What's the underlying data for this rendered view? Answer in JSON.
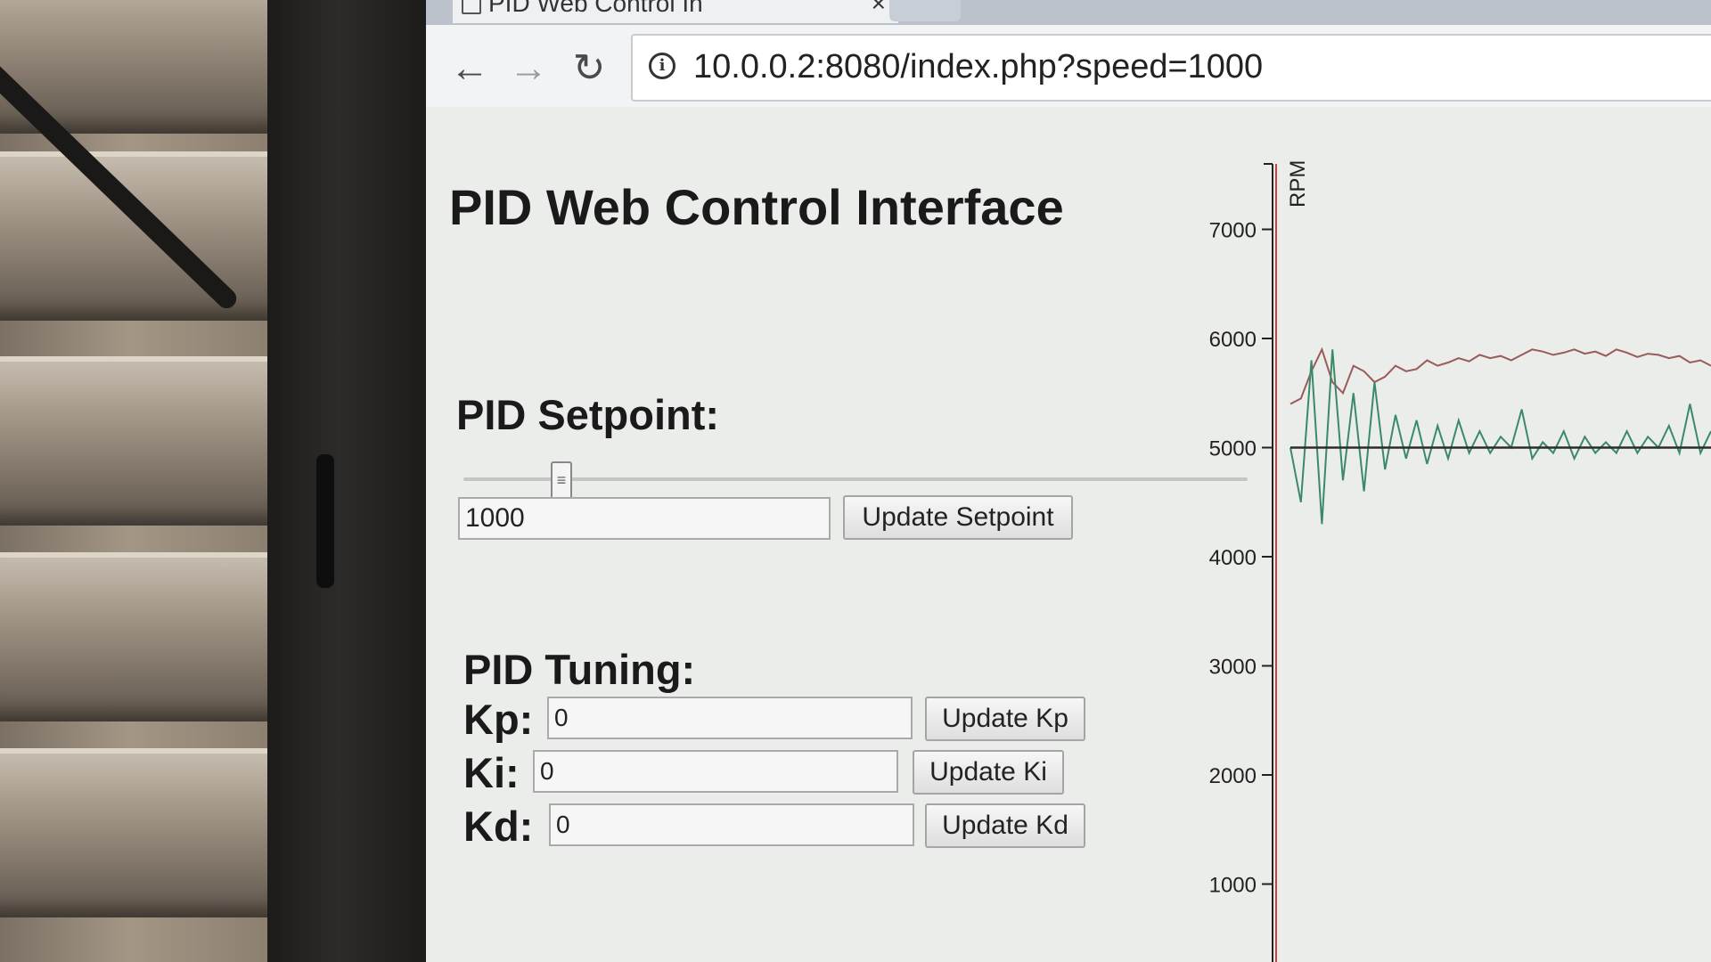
{
  "browser": {
    "tab_title": "PID Web Control In",
    "url": "10.0.0.2:8080/index.php?speed=1000"
  },
  "page": {
    "title": "PID Web Control Interface",
    "setpoint": {
      "heading": "PID Setpoint:",
      "slider_value": 1000,
      "slider_max": 8000,
      "input_value": "1000",
      "button_label": "Update Setpoint"
    },
    "tuning": {
      "heading": "PID Tuning:",
      "kp": {
        "label": "Kp:",
        "value": "0",
        "button_label": "Update Kp"
      },
      "ki": {
        "label": "Ki:",
        "value": "0",
        "button_label": "Update Ki"
      },
      "kd": {
        "label": "Kd:",
        "value": "0",
        "button_label": "Update Kd"
      }
    }
  },
  "colors": {
    "target_line": "#2c2c2c",
    "rpm_series": "#9a5a5a",
    "error_series": "#3a8a6a",
    "axis_red": "#d04040"
  },
  "chart_data": {
    "type": "line",
    "ylabel": "RPM",
    "ylim": [
      0,
      7800
    ],
    "yticks": [
      1000,
      2000,
      3000,
      4000,
      5000,
      6000,
      7000
    ],
    "series": [
      {
        "values": [
          5400,
          5450,
          5700,
          5900,
          5600,
          5500,
          5750,
          5700,
          5600,
          5650,
          5750,
          5700,
          5720,
          5800,
          5750,
          5780,
          5820,
          5790,
          5850,
          5820,
          5840,
          5800,
          5850,
          5900,
          5880,
          5850,
          5870,
          5900,
          5860,
          5880,
          5840,
          5900,
          5870,
          5830,
          5860,
          5850,
          5820,
          5840,
          5780,
          5800,
          5750
        ]
      },
      {
        "values": [
          5000,
          4500,
          5800,
          4300,
          5900,
          4700,
          5500,
          4600,
          5600,
          4800,
          5300,
          4900,
          5250,
          4850,
          5200,
          4900,
          5250,
          4950,
          5150,
          4950,
          5100,
          5000,
          5350,
          4900,
          5050,
          4950,
          5150,
          4900,
          5100,
          4950,
          5050,
          4950,
          5150,
          4950,
          5100,
          5000,
          5200,
          4950,
          5400,
          4950,
          5150
        ]
      },
      {
        "values": [
          5000,
          5000,
          5000,
          5000,
          5000,
          5000,
          5000,
          5000,
          5000,
          5000,
          5000,
          5000,
          5000,
          5000,
          5000,
          5000,
          5000,
          5000,
          5000,
          5000,
          5000,
          5000,
          5000,
          5000,
          5000,
          5000,
          5000,
          5000,
          5000,
          5000,
          5000,
          5000,
          5000,
          5000,
          5000,
          5000,
          5000,
          5000,
          5000,
          5000,
          5000
        ]
      }
    ]
  }
}
